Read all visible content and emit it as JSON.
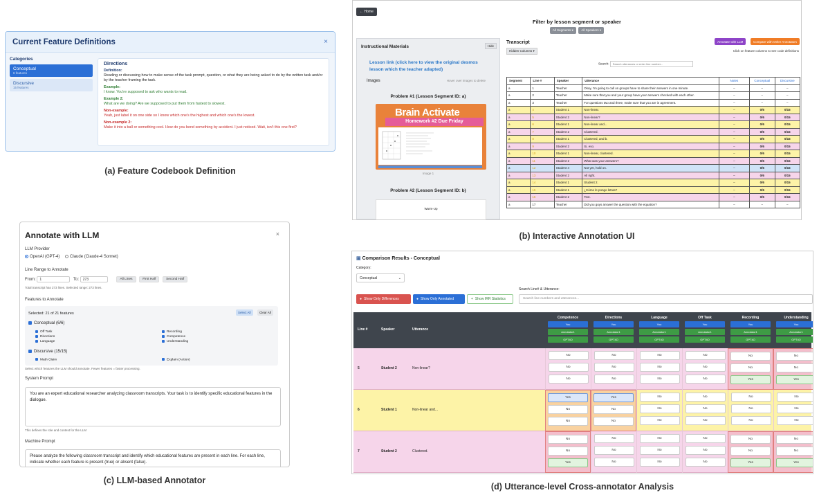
{
  "panel_a": {
    "title": "Current Feature Definitions",
    "close": "×",
    "categories_label": "Categories",
    "categories": [
      {
        "name": "Conceptual",
        "count": "6 features",
        "active": true
      },
      {
        "name": "Discursive",
        "count": "15 features",
        "active": false
      }
    ],
    "feature": "Directions",
    "definition_label": "Definition:",
    "definition": "Reading or discussing how to make sense of the task prompt, question, or what they are being asked to do by the written task and/or by the teacher framing the task.",
    "example_label": "Example:",
    "example": "I know. You're supposed to ask who wants to read.",
    "example2_label": "Example 2:",
    "example2": "What are we doing? Are we supposed to put them from fastest to slowest.",
    "nonexample_label": "Non-example:",
    "nonexample": "Yeah, just label it on one side so I know which one's the highest and which one's the lowest.",
    "nonexample2_label": "Non-example 2:",
    "nonexample2": "Make it into a ball or something cool. How do you bend something by accident. I just noticed. Wait, isn't this one first?",
    "caption": "(a) Feature Codebook Definition"
  },
  "panel_b": {
    "home": "← Home",
    "filter_title": "Filter by lesson segment or speaker",
    "chips": [
      "All Segments ▾",
      "All Speakers ▾"
    ],
    "left_title": "Instructional Materials",
    "hide": "Hide",
    "lesson_link": "Lesson link (click here to view the original desmos lesson which the teacher adapted)",
    "images_label": "Images",
    "hover_note": "Hover over images to delete",
    "problem1": "Problem #1 (Lesson Segment ID: a)",
    "brain": "Brain Activate",
    "homework": "Homework #2 Due Friday",
    "image1": "Image 1",
    "problem2": "Problem #2 (Lesson Segment ID: b)",
    "warmup": "Warm-Up",
    "transcript_title": "Transcript",
    "annotate_btn": "Annotate with LLM",
    "compare_btn": "Compare with Other Annotators",
    "hidden_columns": "Hidden Columns ▾",
    "click_note": "Click on feature columns to see code definitions",
    "search_label": "Search:",
    "search_placeholder": "Search utterances or enter line number...",
    "columns": [
      "Segment",
      "Line #",
      "Speaker",
      "Utterance",
      "Notes",
      "Conceptual",
      "Discursive"
    ],
    "rows": [
      {
        "seg": "a",
        "line": "1",
        "speaker": "Teacher",
        "utt": "Okay, I'm going to call on groups have to share their answers in one minute.",
        "notes": "–",
        "c": "–",
        "d": "–",
        "bg": "#ffffff"
      },
      {
        "seg": "a",
        "line": "2",
        "speaker": "Teacher",
        "utt": "Make sure that you and your group have your answers checked with each other.",
        "notes": "–",
        "c": "–",
        "d": "–",
        "bg": "#ffffff"
      },
      {
        "seg": "a",
        "line": "3",
        "speaker": "Teacher",
        "utt": "For questions two and three, make sure that you are in agreement.",
        "notes": "–",
        "c": "–",
        "d": "–",
        "bg": "#ffffff"
      },
      {
        "seg": "a",
        "line": "4",
        "speaker": "Student 1",
        "utt": "Non-linear.",
        "notes": "–",
        "c": "0/6",
        "d": "0/15",
        "bg": "#fdf3a7"
      },
      {
        "seg": "a",
        "line": "5",
        "speaker": "Student 2",
        "utt": "Non-linear?",
        "notes": "–",
        "c": "0/6",
        "d": "0/15",
        "bg": "#f6d5ea"
      },
      {
        "seg": "a",
        "line": "6",
        "speaker": "Student 1",
        "utt": "Non-linear and...",
        "notes": "–",
        "c": "0/6",
        "d": "0/15",
        "bg": "#fdf3a7"
      },
      {
        "seg": "a",
        "line": "7",
        "speaker": "Student 2",
        "utt": "Clustered.",
        "notes": "–",
        "c": "0/6",
        "d": "0/15",
        "bg": "#f6d5ea"
      },
      {
        "seg": "a",
        "line": "8",
        "speaker": "Student 1",
        "utt": "Clustered, and b.",
        "notes": "–",
        "c": "0/6",
        "d": "0/15",
        "bg": "#fdf3a7"
      },
      {
        "seg": "a",
        "line": "9",
        "speaker": "Student 2",
        "utt": "Si, eso.",
        "notes": "–",
        "c": "0/6",
        "d": "0/15",
        "bg": "#f6d5ea"
      },
      {
        "seg": "a",
        "line": "10",
        "speaker": "Student 1",
        "utt": "Non-linear, clustered.",
        "notes": "–",
        "c": "0/6",
        "d": "0/15",
        "bg": "#fdf3a7"
      },
      {
        "seg": "a",
        "line": "11",
        "speaker": "Student 2",
        "utt": "What was your answers?",
        "notes": "–",
        "c": "0/6",
        "d": "0/15",
        "bg": "#f6d5ea"
      },
      {
        "seg": "a",
        "line": "12",
        "speaker": "Student 4",
        "utt": "Not yet, hold on.",
        "notes": "–",
        "c": "0/6",
        "d": "0/15",
        "bg": "#cfe3f7"
      },
      {
        "seg": "a",
        "line": "13",
        "speaker": "Student 2",
        "utt": "All right.",
        "notes": "–",
        "c": "0/6",
        "d": "0/15",
        "bg": "#f6d5ea"
      },
      {
        "seg": "a",
        "line": "14",
        "speaker": "Student 1",
        "utt": "Student 2.",
        "notes": "–",
        "c": "0/6",
        "d": "0/15",
        "bg": "#fdf3a7"
      },
      {
        "seg": "a",
        "line": "15",
        "speaker": "Student 1",
        "utt": "¿Cómo le pongo letras?",
        "notes": "–",
        "c": "0/6",
        "d": "0/15",
        "bg": "#fdf3a7"
      },
      {
        "seg": "a",
        "line": "16",
        "speaker": "Student 2",
        "utt": "Text.",
        "notes": "–",
        "c": "0/6",
        "d": "0/15",
        "bg": "#f6d5ea"
      },
      {
        "seg": "a",
        "line": "17",
        "speaker": "Teacher",
        "utt": "Did you guys answer the question with the equation?",
        "notes": "–",
        "c": "–",
        "d": "–",
        "bg": "#ffffff"
      }
    ],
    "caption": "(b) Interactive Annotation UI"
  },
  "panel_c": {
    "title": "Annotate with LLM",
    "close": "×",
    "provider_label": "LLM Provider",
    "provider_openai": "OpenAI (GPT-4)",
    "provider_claude": "Claude (Claude-4 Sonnet)",
    "range_label": "Line Range to Annotate",
    "from_label": "From:",
    "from_value": "1",
    "to_label": "To:",
    "to_value": "273",
    "all_lines": "All Lines",
    "first_half": "First Half",
    "second_half": "Second Half",
    "range_note": "Total transcript has 273 lines. Selected range: 273 lines.",
    "features_label": "Features to Annotate",
    "selected": "Selected: 21 of 21 features",
    "select_all": "Select All",
    "clear_all": "Clear All",
    "group1": "Conceptual (6/6)",
    "group1_items": [
      "Off Task",
      "Recording",
      "Directions",
      "Competence",
      "Language",
      "Understanding"
    ],
    "group2": "Discursive (15/15)",
    "group2_items": [
      "Math Claim",
      "Explain (Action)"
    ],
    "features_note": "Select which features the LLM should annotate. Fewer features = faster processing.",
    "system_label": "System Prompt",
    "system_prompt": "You are an expert educational researcher analyzing classroom transcripts. Your task is to identify specific educational features in the dialogue.",
    "system_note": "This defines the role and context for the LLM",
    "machine_label": "Machine Prompt",
    "machine_prompt": "Please analyze the following classroom transcript and identify which educational features are present in each line. For each line, indicate whether each feature is present (true) or absent (false).",
    "caption": "(c) LLM-based Annotator"
  },
  "panel_d": {
    "title": "Comparison Results - Conceptual",
    "category_label": "Category:",
    "category_value": "Conceptual",
    "search_label": "Search Line# & Utterance:",
    "btn_diff": "Show Only Differences",
    "btn_annot": "Show Only Annotated",
    "btn_irr": "Show IRR Statistics",
    "search_placeholder": "Search line numbers and utterances...",
    "head": [
      "Line #",
      "Speaker",
      "Utterance"
    ],
    "features": [
      "Competence",
      "Directions",
      "Language",
      "Off Task",
      "Recording",
      "Understanding"
    ],
    "annotators": [
      "You",
      "Annotator1",
      "GPT4O"
    ],
    "rows": [
      {
        "line": "5",
        "speaker": "Student 2",
        "utt": "Non-linear?",
        "bg": "#f6d5ea",
        "vals": [
          [
            "No",
            "No",
            "No"
          ],
          [
            "No",
            "No",
            "No"
          ],
          [
            "No",
            "No",
            "No"
          ],
          [
            "No",
            "No",
            "No"
          ],
          [
            "No",
            "No",
            "Yes"
          ],
          [
            "No",
            "No",
            "Yes"
          ]
        ]
      },
      {
        "line": "6",
        "speaker": "Student 1",
        "utt": "Non-linear and...",
        "bg": "#fdf3a7",
        "vals": [
          [
            "Yes",
            "No",
            "No"
          ],
          [
            "Yes",
            "No",
            "No"
          ],
          [
            "No",
            "No",
            "No"
          ],
          [
            "No",
            "No",
            "No"
          ],
          [
            "No",
            "No",
            "No"
          ],
          [
            "No",
            "No",
            "No"
          ]
        ]
      },
      {
        "line": "7",
        "speaker": "Student 2",
        "utt": "Clustered.",
        "bg": "#f6d5ea",
        "vals": [
          [
            "No",
            "No",
            "Yes"
          ],
          [
            "No",
            "No",
            "No"
          ],
          [
            "No",
            "No",
            "No"
          ],
          [
            "No",
            "No",
            "No"
          ],
          [
            "No",
            "No",
            "Yes"
          ],
          [
            "No",
            "No",
            "Yes"
          ]
        ]
      }
    ],
    "caption": "(d) Utterance-level Cross-annotator Analysis"
  }
}
